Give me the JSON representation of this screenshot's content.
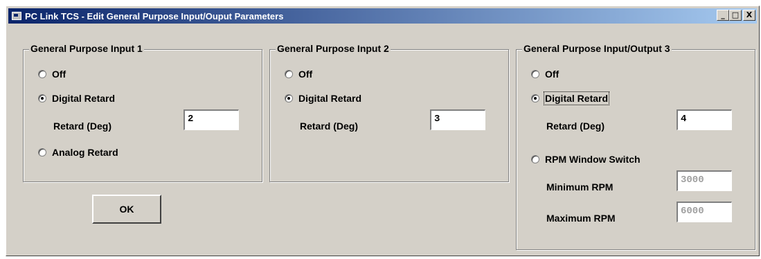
{
  "window": {
    "title": "PC Link TCS - Edit General Purpose Input/Ouput Parameters",
    "buttons": {
      "minimize": "_",
      "maximize": "□",
      "close": "X"
    }
  },
  "group1": {
    "title": "General Purpose Input 1",
    "off_label": "Off",
    "digital_label": "Digital Retard",
    "retard_label": "Retard (Deg)",
    "retard_value": "2",
    "analog_label": "Analog Retard",
    "selected": "digital"
  },
  "group2": {
    "title": "General Purpose Input 2",
    "off_label": "Off",
    "digital_label": "Digital Retard",
    "retard_label": "Retard (Deg)",
    "retard_value": "3",
    "selected": "digital"
  },
  "group3": {
    "title": "General Purpose Input/Output 3",
    "off_label": "Off",
    "digital_label": "Digital Retard",
    "retard_label": "Retard (Deg)",
    "retard_value": "4",
    "rpm_label": "RPM Window Switch",
    "min_rpm_label": "Minimum RPM",
    "min_rpm_value": "3000",
    "max_rpm_label": "Maximum RPM",
    "max_rpm_value": "6000",
    "selected": "digital"
  },
  "ok_label": "OK"
}
